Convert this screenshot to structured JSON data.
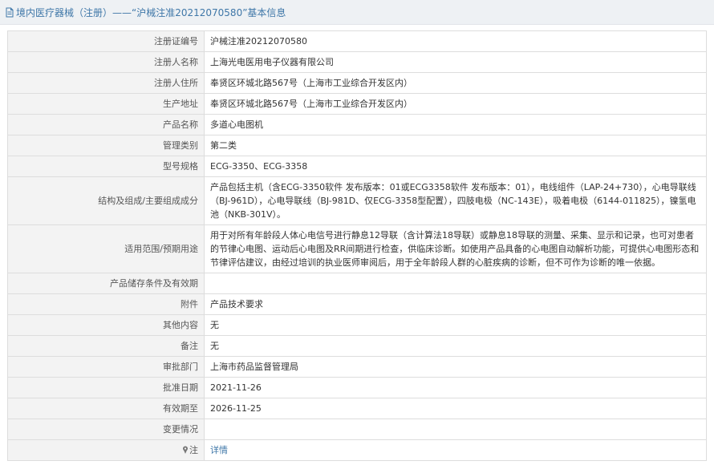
{
  "header": {
    "text": "境内医疗器械（注册）——“沪械注准20212070580”基本信息"
  },
  "rows": [
    {
      "label": "注册证编号",
      "value": "沪械注准20212070580"
    },
    {
      "label": "注册人名称",
      "value": "上海光电医用电子仪器有限公司"
    },
    {
      "label": "注册人住所",
      "value": "奉贤区环城北路567号（上海市工业综合开发区内）"
    },
    {
      "label": "生产地址",
      "value": "奉贤区环城北路567号（上海市工业综合开发区内）"
    },
    {
      "label": "产品名称",
      "value": "多道心电图机"
    },
    {
      "label": "管理类别",
      "value": "第二类"
    },
    {
      "label": "型号规格",
      "value": "ECG-3350、ECG-3358"
    },
    {
      "label": "结构及组成/主要组成成分",
      "value": "产品包括主机（含ECG-3350软件 发布版本：01或ECG3358软件 发布版本：01），电线组件（LAP-24+730），心电导联线（BJ-961D），心电导联线（BJ-981D、仅ECG-3358型配置），四肢电极（NC-143E），吸着电极（6144-011825），镍氢电池（NKB-301V）。"
    },
    {
      "label": "适用范围/预期用途",
      "value": "用于对所有年龄段人体心电信号进行静息12导联（含计算法18导联）或静息18导联的测量、采集、显示和记录，也可对患者的节律心电图、运动后心电图及RR间期进行检查，供临床诊断。如使用产品具备的心电图自动解析功能，可提供心电图形态和节律评估建议，由经过培训的执业医师审阅后，用于全年龄段人群的心脏疾病的诊断，但不可作为诊断的唯一依据。"
    },
    {
      "label": "产品储存条件及有效期",
      "value": ""
    },
    {
      "label": "附件",
      "value": "产品技术要求"
    },
    {
      "label": "其他内容",
      "value": "无"
    },
    {
      "label": "备注",
      "value": "无"
    },
    {
      "label": "审批部门",
      "value": "上海市药品监督管理局"
    },
    {
      "label": "批准日期",
      "value": "2021-11-26"
    },
    {
      "label": "有效期至",
      "value": "2026-11-25"
    },
    {
      "label": "变更情况",
      "value": ""
    }
  ],
  "note": {
    "label": "注",
    "link_text": "详情"
  },
  "icons": {
    "header": "document-icon",
    "note": "pin-icon"
  },
  "colors": {
    "link": "#3f77a8",
    "label_bg": "#f3f3f3",
    "header_bg": "#eef1f4"
  }
}
